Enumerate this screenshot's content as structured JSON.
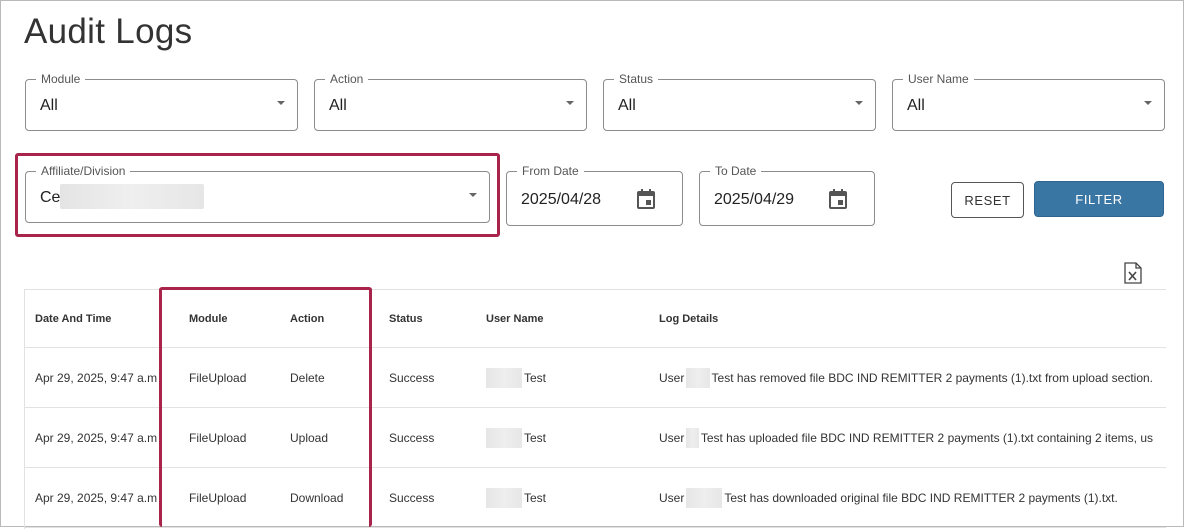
{
  "page": {
    "title": "Audit Logs"
  },
  "filters": {
    "module": {
      "label": "Module",
      "value": "All"
    },
    "action": {
      "label": "Action",
      "value": "All"
    },
    "status": {
      "label": "Status",
      "value": "All"
    },
    "user_name": {
      "label": "User Name",
      "value": "All"
    },
    "affiliate": {
      "label": "Affiliate/Division",
      "value": "Ce"
    },
    "from_date": {
      "label": "From Date",
      "value": "2025/04/28"
    },
    "to_date": {
      "label": "To Date",
      "value": "2025/04/29"
    }
  },
  "buttons": {
    "reset": "RESET",
    "filter": "FILTER"
  },
  "icons": {
    "calendar": "calendar-icon",
    "excel": "excel-export-icon",
    "dropdown": "chevron-down-icon"
  },
  "colors": {
    "filter_button": "#3a76a4",
    "highlight": "#a8244a"
  },
  "table": {
    "columns": [
      "Date And Time",
      "Module",
      "Action",
      "Status",
      "User Name",
      "Log Details"
    ],
    "rows": [
      {
        "date": "Apr 29, 2025, 9:47 a.m.",
        "module": "FileUpload",
        "action": "Delete",
        "status": "Success",
        "user": "Test",
        "log_prefix": "User",
        "log_text": "Test has removed file BDC IND REMITTER 2 payments (1).txt from upload section."
      },
      {
        "date": "Apr 29, 2025, 9:47 a.m.",
        "module": "FileUpload",
        "action": "Upload",
        "status": "Success",
        "user": "Test",
        "log_prefix": "User",
        "log_text": "Test has uploaded file BDC IND REMITTER 2 payments (1).txt containing 2 items, us"
      },
      {
        "date": "Apr 29, 2025, 9:47 a.m.",
        "module": "FileUpload",
        "action": "Download",
        "status": "Success",
        "user": "Test",
        "log_prefix": "User",
        "log_text": "Test has downloaded original file BDC IND REMITTER 2 payments (1).txt."
      }
    ]
  }
}
